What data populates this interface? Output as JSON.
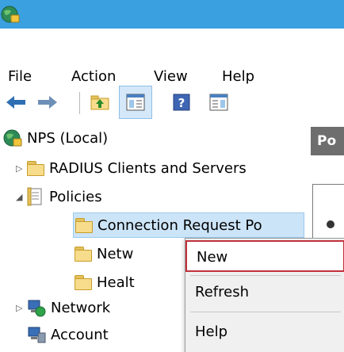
{
  "menu": [
    "File",
    "Action",
    "View",
    "Help"
  ],
  "icons": {
    "app": "nps-globe-icon",
    "back": "back-arrow-icon",
    "forward": "forward-arrow-icon",
    "up": "up-folder-icon",
    "show_hide": "show-hide-console-tree-icon",
    "help": "help-icon",
    "action_pane": "action-pane-icon"
  },
  "tree": {
    "root": "NPS (Local)",
    "radius": "RADIUS Clients and Servers",
    "policies": "Policies",
    "conn_req": "Connection Request Po",
    "network_pol": "Netw",
    "health_pol": "Healt",
    "network_access": "Network",
    "accounting": "Account"
  },
  "right_pane": {
    "header": "Po"
  },
  "context_menu": {
    "items": [
      "New",
      "Refresh",
      "Help"
    ]
  },
  "colors": {
    "titlebar": "#3aa0df",
    "highlight_border": "#c0303a",
    "selection": "#cce4f7"
  }
}
